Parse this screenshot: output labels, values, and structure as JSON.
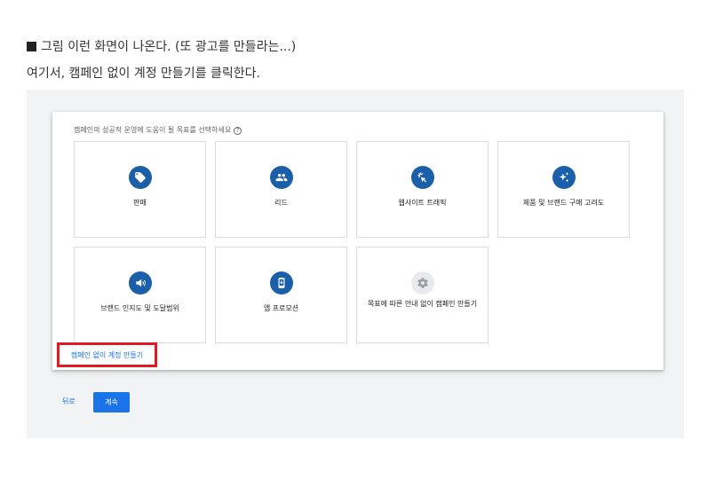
{
  "intro": {
    "line1": "그림 이런 화면이 나온다. (또 광고를 만들라는...)",
    "line2": "여기서, 캠페인 없이 계정 만들기를 클릭한다."
  },
  "card": {
    "prompt": "캠페인의 성공적 운영에 도움이 될 목표를 선택하세요",
    "help_glyph": "?",
    "goals": [
      {
        "label": "판매",
        "icon": "tag-icon"
      },
      {
        "label": "리드",
        "icon": "people-icon"
      },
      {
        "label": "웹사이트 트래픽",
        "icon": "cursor-click-icon"
      },
      {
        "label": "제품 및 브랜드 구매 고려도",
        "icon": "sparkle-icon"
      },
      {
        "label": "브랜드 인지도 및 도달범위",
        "icon": "megaphone-icon"
      },
      {
        "label": "앱 프로모션",
        "icon": "phone-icon"
      },
      {
        "label": "목표에 따른 안내 없이 캠페인 만들기",
        "icon": "gear-icon"
      }
    ],
    "no_campaign_link": "캠페인 없이 계정 만들기"
  },
  "footer": {
    "back_label": "뒤로",
    "continue_label": "계속"
  },
  "colors": {
    "accent": "#1a73e8",
    "icon_bg": "#1a5fa8",
    "highlight": "#e01b24",
    "panel_bg": "#f1f3f4"
  }
}
